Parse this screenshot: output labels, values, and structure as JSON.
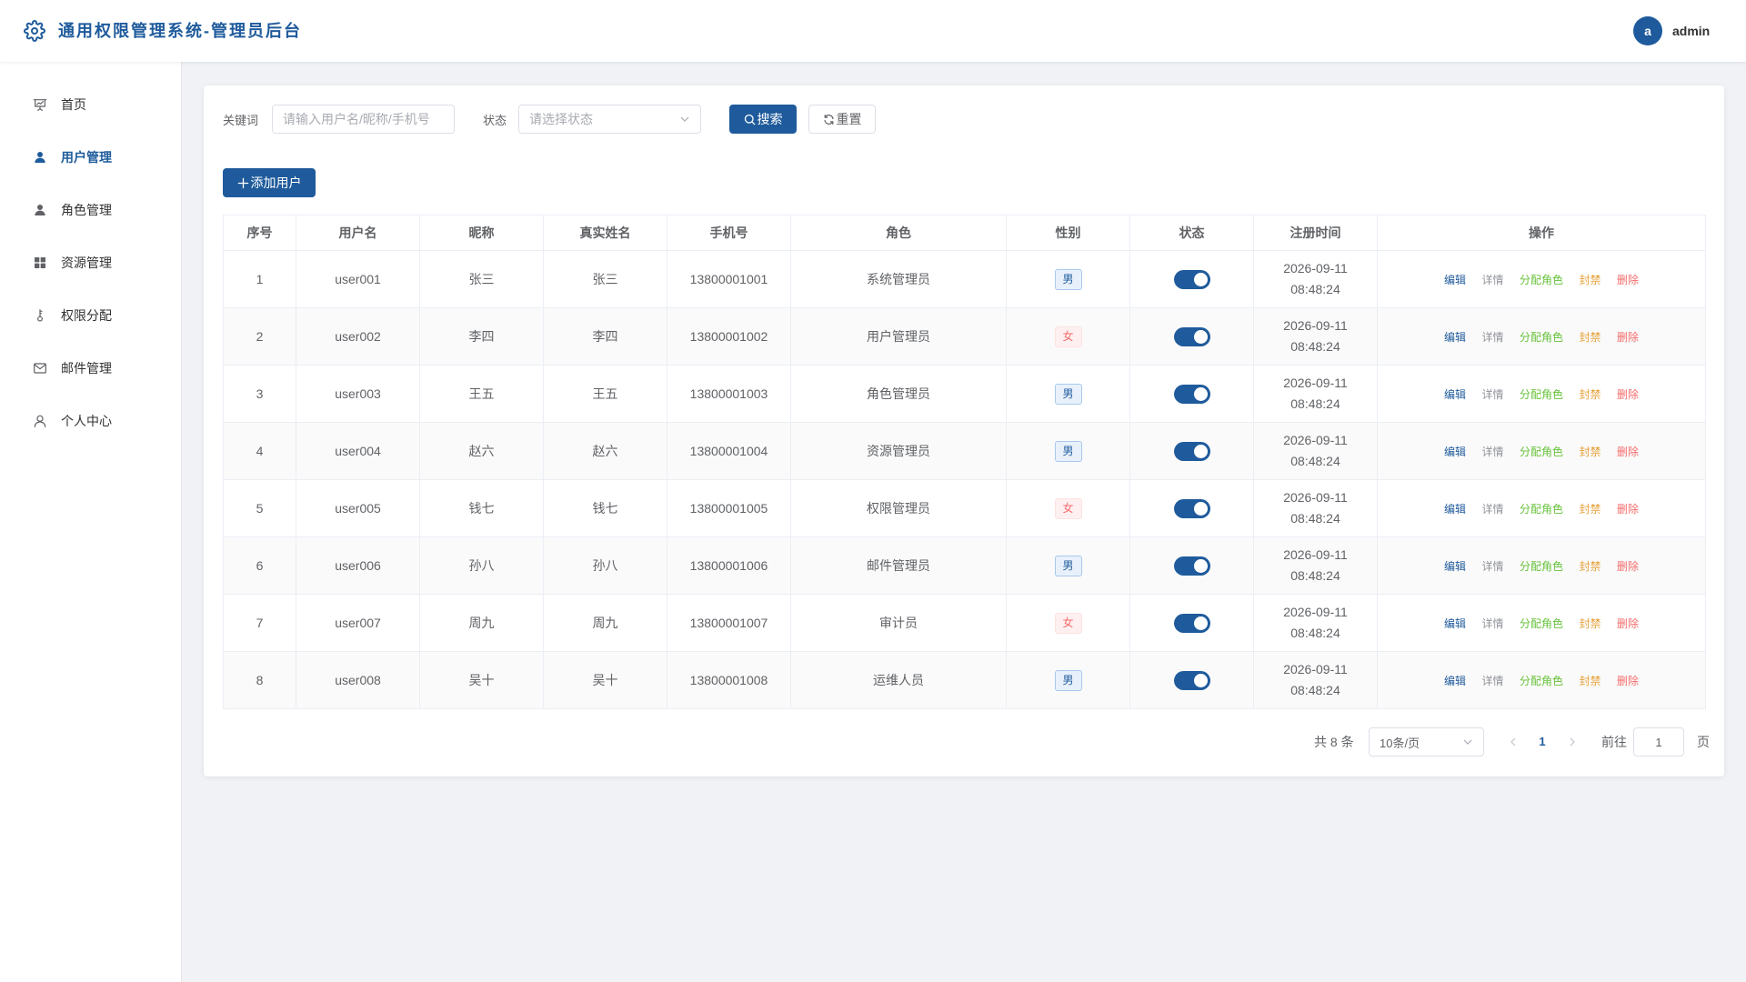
{
  "app": {
    "title": "通用权限管理系统-管理员后台",
    "logo_icon": "gear-icon"
  },
  "user": {
    "avatar_letter": "a",
    "name": "admin"
  },
  "sidebar": {
    "items": [
      {
        "label": "首页",
        "icon": "dashboard-icon",
        "active": false
      },
      {
        "label": "用户管理",
        "icon": "user-icon",
        "active": true
      },
      {
        "label": "角色管理",
        "icon": "role-icon",
        "active": false
      },
      {
        "label": "资源管理",
        "icon": "grid-icon",
        "active": false
      },
      {
        "label": "权限分配",
        "icon": "key-icon",
        "active": false
      },
      {
        "label": "邮件管理",
        "icon": "mail-icon",
        "active": false
      },
      {
        "label": "个人中心",
        "icon": "profile-icon",
        "active": false
      }
    ]
  },
  "search": {
    "keyword_label": "关键词",
    "keyword_value": "",
    "keyword_placeholder": "请输入用户名/昵称/手机号",
    "status_label": "状态",
    "status_placeholder": "请选择状态",
    "search_button": "搜索",
    "reset_button": "重置"
  },
  "toolbar": {
    "add_button": "添加用户"
  },
  "table": {
    "columns": [
      "序号",
      "用户名",
      "昵称",
      "真实姓名",
      "手机号",
      "角色",
      "性别",
      "状态",
      "注册时间",
      "操作"
    ],
    "rows": [
      {
        "index": "1",
        "username": "user001",
        "nickname": "张三",
        "real_name": "张三",
        "phone": "13800001001",
        "role": "系统管理员",
        "gender": "男",
        "enabled": true,
        "reg_date": "2026-09-11",
        "reg_time": "08:48:24"
      },
      {
        "index": "2",
        "username": "user002",
        "nickname": "李四",
        "real_name": "李四",
        "phone": "13800001002",
        "role": "用户管理员",
        "gender": "女",
        "enabled": true,
        "reg_date": "2026-09-11",
        "reg_time": "08:48:24"
      },
      {
        "index": "3",
        "username": "user003",
        "nickname": "王五",
        "real_name": "王五",
        "phone": "13800001003",
        "role": "角色管理员",
        "gender": "男",
        "enabled": true,
        "reg_date": "2026-09-11",
        "reg_time": "08:48:24"
      },
      {
        "index": "4",
        "username": "user004",
        "nickname": "赵六",
        "real_name": "赵六",
        "phone": "13800001004",
        "role": "资源管理员",
        "gender": "男",
        "enabled": true,
        "reg_date": "2026-09-11",
        "reg_time": "08:48:24"
      },
      {
        "index": "5",
        "username": "user005",
        "nickname": "钱七",
        "real_name": "钱七",
        "phone": "13800001005",
        "role": "权限管理员",
        "gender": "女",
        "enabled": true,
        "reg_date": "2026-09-11",
        "reg_time": "08:48:24"
      },
      {
        "index": "6",
        "username": "user006",
        "nickname": "孙八",
        "real_name": "孙八",
        "phone": "13800001006",
        "role": "邮件管理员",
        "gender": "男",
        "enabled": true,
        "reg_date": "2026-09-11",
        "reg_time": "08:48:24"
      },
      {
        "index": "7",
        "username": "user007",
        "nickname": "周九",
        "real_name": "周九",
        "phone": "13800001007",
        "role": "审计员",
        "gender": "女",
        "enabled": true,
        "reg_date": "2026-09-11",
        "reg_time": "08:48:24"
      },
      {
        "index": "8",
        "username": "user008",
        "nickname": "吴十",
        "real_name": "吴十",
        "phone": "13800001008",
        "role": "运维人员",
        "gender": "男",
        "enabled": true,
        "reg_date": "2026-09-11",
        "reg_time": "08:48:24"
      }
    ],
    "actions": [
      "编辑",
      "详情",
      "分配角色",
      "封禁",
      "删除"
    ]
  },
  "pagination": {
    "total_text": "共 8 条",
    "page_size": "10条/页",
    "current_page": "1",
    "goto_label": "前往",
    "goto_value": "1",
    "page_suffix": "页"
  },
  "colors": {
    "primary": "#1f5b9c",
    "background": "#f0f2f5",
    "male_tag": "#1f5b9c",
    "female_tag": "#f56c6c",
    "action_edit": "#1f5b9c",
    "action_detail": "#909399",
    "action_assign_role": "#67c23a",
    "action_ban": "#e6a23c",
    "action_delete": "#f56c6c"
  }
}
